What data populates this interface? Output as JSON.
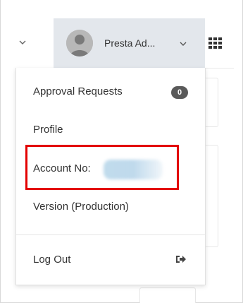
{
  "topbar": {
    "left_chevron_icon": "chevron-down-icon",
    "grid_icon": "grid-menu-icon"
  },
  "user_menu": {
    "display_name": "Presta Ad...",
    "avatar_icon": "user-avatar-icon",
    "chevron_icon": "chevron-down-icon"
  },
  "dropdown": {
    "items": [
      {
        "label": "Approval Requests",
        "badge": "0"
      },
      {
        "label": "Profile"
      },
      {
        "label": "Account No:",
        "value_redacted": true
      },
      {
        "label": "Version (Production)"
      }
    ],
    "logout": {
      "label": "Log Out",
      "icon": "sign-out-icon"
    }
  },
  "colors": {
    "header_active_bg": "#e3e7ec",
    "badge_bg": "#5a5a5a",
    "highlight_border": "#e30000",
    "text": "#333333"
  }
}
